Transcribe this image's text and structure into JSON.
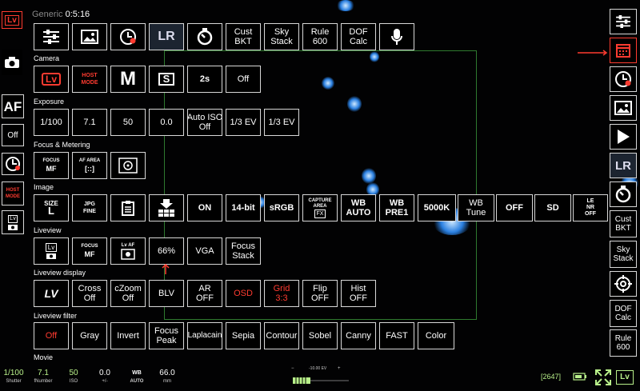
{
  "timer": {
    "left_label": "Generic",
    "value": "0:5:16"
  },
  "top_row": [
    {
      "icon": "sliders-icon"
    },
    {
      "icon": "image-icon"
    },
    {
      "icon": "timelapse-icon"
    },
    {
      "icon": "lr-timelapse-icon",
      "label": "LR"
    },
    {
      "icon": "self-timer-icon"
    },
    {
      "label_1": "Cust",
      "label_2": "BKT"
    },
    {
      "label_1": "Sky",
      "label_2": "Stack"
    },
    {
      "label_1": "Rule",
      "label_2": "600"
    },
    {
      "label_1": "DOF",
      "label_2": "Calc"
    },
    {
      "icon": "microphone-icon"
    }
  ],
  "sections": {
    "camera": "Camera",
    "exposure": "Exposure",
    "focus_metering": "Focus & Metering",
    "image": "Image",
    "liveview": "Liveview",
    "liveview_display": "Liveview display",
    "liveview_filter": "Liveview filter",
    "movie": "Movie"
  },
  "camera": {
    "lv_label": "Lv",
    "host_mode_1": "HOST",
    "host_mode_2": "MODE",
    "mode": "M",
    "drive_label": "S",
    "timer": "2s",
    "off": "Off"
  },
  "exposure": {
    "shutter": "1/100",
    "aperture": "7.1",
    "iso": "50",
    "ev": "0.0",
    "auto_iso_1": "Auto ISO",
    "auto_iso_2": "Off",
    "ev_step_1": "1/3 EV",
    "ev_step_2": "1/3 EV"
  },
  "focus_metering": {
    "focus_small": "FOCUS",
    "focus_big": "MF",
    "af_area_small": "AF AREA",
    "af_area_big": "[::]"
  },
  "image": {
    "size_small": "SIZE",
    "size_big": "L",
    "jpg_1": "JPG",
    "jpg_2": "FINE",
    "on_label": "ON",
    "bit": "14-bit",
    "srgb": "sRGB",
    "capture_small": "CAPTURE AREA",
    "capture_big": "FX",
    "wb1_1": "WB",
    "wb1_2": "AUTO",
    "wb2_1": "WB",
    "wb2_2": "PRE1",
    "kelvin": "5000K",
    "wb_tune_1": "WB",
    "wb_tune_2": "Tune",
    "off": "OFF",
    "sd": "SD",
    "lenr_1": "LE",
    "lenr_2": "NR",
    "lenr_3": "OFF"
  },
  "liveview": {
    "lv": "Lv",
    "focus_small": "FOCUS",
    "focus_big": "MF",
    "lvaf_small": "Lv AF",
    "zoom": "66%",
    "vga": "VGA",
    "focus_stack_1": "Focus",
    "focus_stack_2": "Stack"
  },
  "liveview_display": {
    "lv": "LV",
    "cross_1": "Cross",
    "cross_2": "Off",
    "czoom_1": "cZoom",
    "czoom_2": "Off",
    "blv": "BLV",
    "ar_1": "AR",
    "ar_2": "OFF",
    "osd": "OSD",
    "grid_1": "Grid",
    "grid_2": "3:3",
    "flip_1": "Flip",
    "flip_2": "OFF",
    "hist_1": "Hist",
    "hist_2": "OFF"
  },
  "liveview_filter": [
    "Off",
    "Gray",
    "Invert",
    "Focus Peak",
    "Laplacain",
    "Sepia",
    "Contour",
    "Sobel",
    "Canny",
    "FAST",
    "Color"
  ],
  "left_bar": {
    "lv": "Lv",
    "af": "AF",
    "off": "Off",
    "host_1": "HOST",
    "host_2": "MODE",
    "lv2": "Lv"
  },
  "right_bar": {
    "cust_1": "Cust",
    "cust_2": "BKT",
    "sky_1": "Sky",
    "sky_2": "Stack",
    "dof_1": "DOF",
    "dof_2": "Calc",
    "rule_1": "Rule",
    "rule_2": "600"
  },
  "status_bar": {
    "shutter": {
      "value": "1/100",
      "label": "Shutter"
    },
    "fnumber": {
      "value": "7.1",
      "label": "fNumber"
    },
    "iso": {
      "value": "50",
      "label": "ISO"
    },
    "ev": {
      "value": "0.0",
      "label": "+/-"
    },
    "wb": {
      "value": "WB",
      "label": "AUTO"
    },
    "focal": {
      "value": "66.0",
      "label": "mm"
    },
    "slider_label": "-10.00 EV",
    "minus": "−",
    "plus": "+",
    "shots": "[2647]",
    "lv": "Lv"
  },
  "colors": {
    "accent_red": "#ff3b30",
    "green_text": "#b8f08a",
    "frame": "#2f7a2f"
  }
}
